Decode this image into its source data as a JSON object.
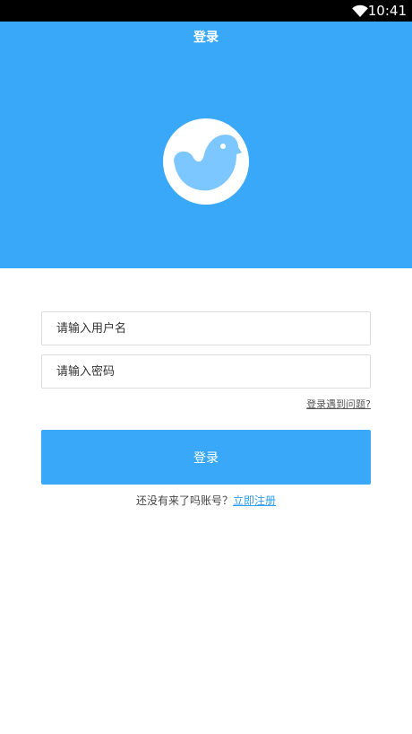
{
  "status_bar": {
    "time": "10:41",
    "icon": "wifi-icon"
  },
  "header": {
    "title": "登录",
    "logo_icon": "bird-logo-icon"
  },
  "form": {
    "username_placeholder": "请输入用户名",
    "username_value": "",
    "password_placeholder": "请输入密码",
    "password_value": "",
    "help_link": "登录遇到问题?",
    "login_button": "登录",
    "register_prompt": "还没有来了吗账号？",
    "register_link": "立即注册"
  },
  "colors": {
    "primary": "#3aa8f8",
    "link": "#2f9df0",
    "status_bar": "#000000"
  }
}
